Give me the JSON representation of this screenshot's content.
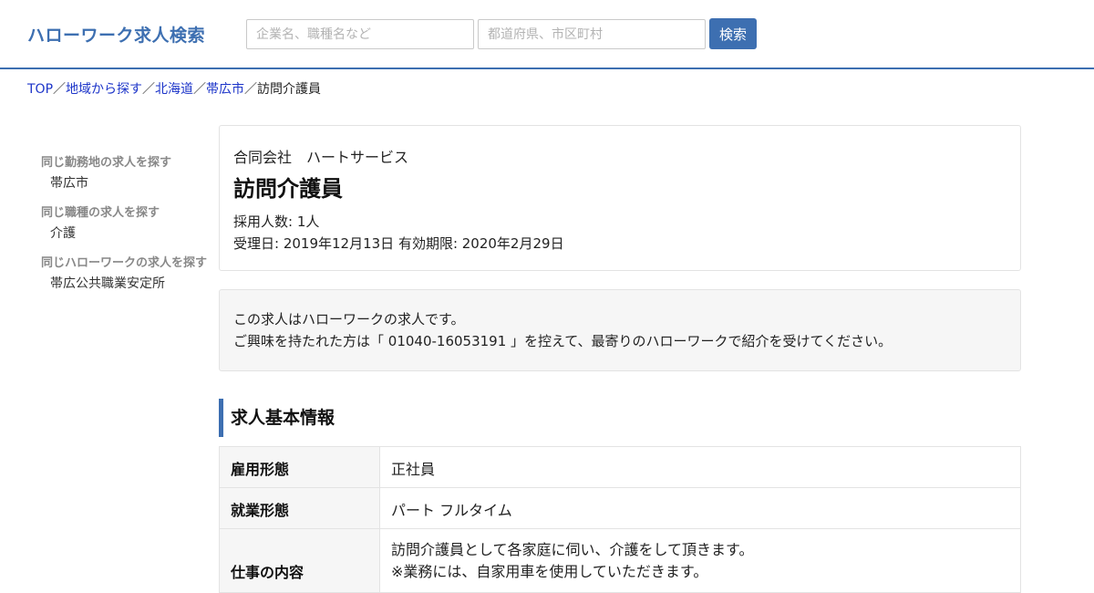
{
  "header": {
    "site_title": "ハローワーク求人検索",
    "keyword_placeholder": "企業名、職種名など",
    "area_placeholder": "都道府県、市区町村",
    "search_button": "検索"
  },
  "breadcrumb": {
    "items": [
      "TOP",
      "地域から探す",
      "北海道",
      "帯広市"
    ],
    "current": "訪問介護員",
    "separator": "／"
  },
  "sidebar": {
    "sections": [
      {
        "heading": "同じ勤務地の求人を探す",
        "link": "帯広市"
      },
      {
        "heading": "同じ職種の求人を探す",
        "link": "介護"
      },
      {
        "heading": "同じハローワークの求人を探す",
        "link": "帯広公共職業安定所"
      }
    ]
  },
  "job": {
    "company": "合同会社　ハートサービス",
    "title": "訪問介護員",
    "hires": "採用人数: 1人",
    "dates": "受理日: 2019年12月13日 有効期限: 2020年2月29日"
  },
  "notice": {
    "line1": "この求人はハローワークの求人です。",
    "line2": "ご興味を持たれた方は「 01040-16053191 」を控えて、最寄りのハローワークで紹介を受けてください。"
  },
  "basic_info": {
    "heading": "求人基本情報",
    "rows": [
      {
        "label": "雇用形態",
        "value": "正社員"
      },
      {
        "label": "就業形態",
        "value": "パート フルタイム"
      },
      {
        "label": "仕事の内容",
        "value_lines": [
          "訪問介護員として各家庭に伺い、介護をして頂きます。",
          "※業務には、自家用車を使用していただきます。"
        ]
      }
    ]
  },
  "colors": {
    "accent": "#3d6fb1",
    "link": "#1d35c9"
  }
}
